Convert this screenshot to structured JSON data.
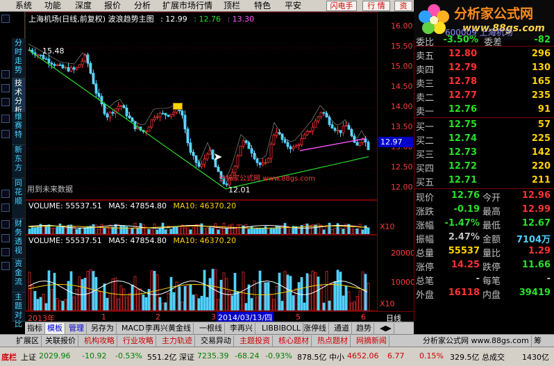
{
  "menu": [
    "系统",
    "功能",
    "深度",
    "报价",
    "分析",
    "扩展市场行情",
    "顶栏",
    "特色",
    "平安"
  ],
  "menu_buttons": [
    "闪电手",
    "行 情",
    "资"
  ],
  "logo": {
    "title": "分析家公式网",
    "url": "www.88gs.com",
    "code_text": "600009 上海机场"
  },
  "price_chart": {
    "title": "上海机场(日线,前复权) 波浪趋势主图",
    "values": [
      {
        "label": ": 12.99",
        "color": "#ffffff"
      },
      {
        "label": ": 12.76",
        "color": "#2adf2a"
      },
      {
        "label": ": 13.30",
        "color": "#ff55ff"
      }
    ],
    "high_label": "15.48",
    "low_label": "12.01",
    "future_text": "用到未来数据",
    "watermark": "分析家公式网 www.88gs.com",
    "current_price_tag": "12.97",
    "axis": [
      "16.00",
      "15.50",
      "15.00",
      "14.50",
      "14.00",
      "13.50",
      "13.00",
      "12.50",
      "12.00"
    ]
  },
  "volume_pane_1": {
    "title": "VOLUME: 55537.51",
    "ma5": "MA5: 47854.80",
    "ma10": "MA10: 46370.20",
    "unit": "X10"
  },
  "volume_pane_2": {
    "title": "VOLUME: 55537.51",
    "ma5": "MA5: 47854.80",
    "ma10": "MA10: 46370.20",
    "axis": [
      "20000",
      "10000"
    ],
    "unit": "X10"
  },
  "date_axis": {
    "ticks": [
      "2013年",
      "1",
      "2",
      "3",
      "4",
      "5",
      "6"
    ],
    "cursor_date": "2014/03/13/四",
    "period": "日线"
  },
  "left_tabs": [
    "分时走势",
    "技术分析",
    "维赛特",
    "新东方",
    "同花顺",
    "财务透视",
    "资金流",
    "主题对比"
  ],
  "indicator_tabs": [
    "指标",
    "模板",
    "管理",
    "另存为",
    "MACD",
    "李再兴黄金线",
    "一根线",
    "李再兴",
    "LIBBIBOLL",
    "涨停线",
    "通道",
    "趋势"
  ],
  "bottom_nav": [
    "扩展区",
    "关联报价",
    "机构攻略",
    "行业攻略",
    "主力轨迹",
    "交易异动",
    "主题投资",
    "核心题材",
    "热点题材",
    "网摘新闻",
    "分析家公式网 www.88gs.com",
    "筹"
  ],
  "status_bar": {
    "prefix": "底栏",
    "sh_label": "上证",
    "sh_value": "2029.96",
    "sh_change": "-10.92",
    "sh_pct": "-0.53%",
    "sh_amount": "551.2亿",
    "sz_label": "深证",
    "sz_value": "7235.39",
    "sz_change": "-68.24",
    "sz_pct": "-0.93%",
    "sz_amount": "878.5亿",
    "zx_label": "中小",
    "zx_value": "4652.06",
    "zx_change": "6.77",
    "zx_pct": "0.15%",
    "zx_amount": "329.5亿",
    "last_label": "总成交",
    "last_value": "1430亿"
  },
  "quote": {
    "top_row": {
      "label": "委比",
      "value": "-3.50%",
      "label2": "委差",
      "value2": "-82"
    },
    "asks": [
      {
        "label": "卖五",
        "price": "12.80",
        "vol": "296"
      },
      {
        "label": "卖四",
        "price": "12.79",
        "vol": "130"
      },
      {
        "label": "卖三",
        "price": "12.78",
        "vol": "165"
      },
      {
        "label": "卖二",
        "price": "12.77",
        "vol": "235"
      },
      {
        "label": "卖一",
        "price": "12.76",
        "vol": "91"
      }
    ],
    "bids": [
      {
        "label": "买一",
        "price": "12.75",
        "vol": "57"
      },
      {
        "label": "买二",
        "price": "12.74",
        "vol": "225"
      },
      {
        "label": "买三",
        "price": "12.73",
        "vol": "142"
      },
      {
        "label": "买四",
        "price": "12.72",
        "vol": "220"
      },
      {
        "label": "买五",
        "price": "12.71",
        "vol": "211"
      }
    ],
    "stats": [
      {
        "l1": "现价",
        "v1": "12.76",
        "c1": "#2adf2a",
        "l2": "今开",
        "v2": "12.96",
        "c2": "#ff3232"
      },
      {
        "l1": "涨跌",
        "v1": "-0.19",
        "c1": "#2adf2a",
        "l2": "最高",
        "v2": "12.99",
        "c2": "#ff3232"
      },
      {
        "l1": "涨幅",
        "v1": "-1.47%",
        "c1": "#2adf2a",
        "l2": "最低",
        "v2": "12.67",
        "c2": "#2adf2a"
      },
      {
        "l1": "振幅",
        "v1": "2.47%",
        "c1": "#c0c0c0",
        "l2": "金额",
        "v2": "7104万",
        "c2": "#4fd2ff"
      },
      {
        "l1": "总量",
        "v1": "55537",
        "c1": "#ffd200",
        "l2": "量比",
        "v2": "1.29",
        "c2": "#ff3232"
      },
      {
        "l1": "涨停",
        "v1": "14.25",
        "c1": "#ff3232",
        "l2": "跌停",
        "v2": "11.66",
        "c2": "#2adf2a"
      },
      {
        "l1": "总笔",
        "v1": "-",
        "c1": "#c0c0c0",
        "l2": "每笔",
        "v2": "-",
        "c2": "#c0c0c0"
      },
      {
        "l1": "外盘",
        "v1": "16118",
        "c1": "#ff3232",
        "l2": "内盘",
        "v2": "39419",
        "c2": "#2adf2a"
      }
    ]
  },
  "colors": {
    "up": "#ff3232",
    "down": "#4fd2ff",
    "ma": "#ffffff",
    "trend": "#2adf2a",
    "wedge": "#ff55ff",
    "grid": "#7a0000"
  }
}
